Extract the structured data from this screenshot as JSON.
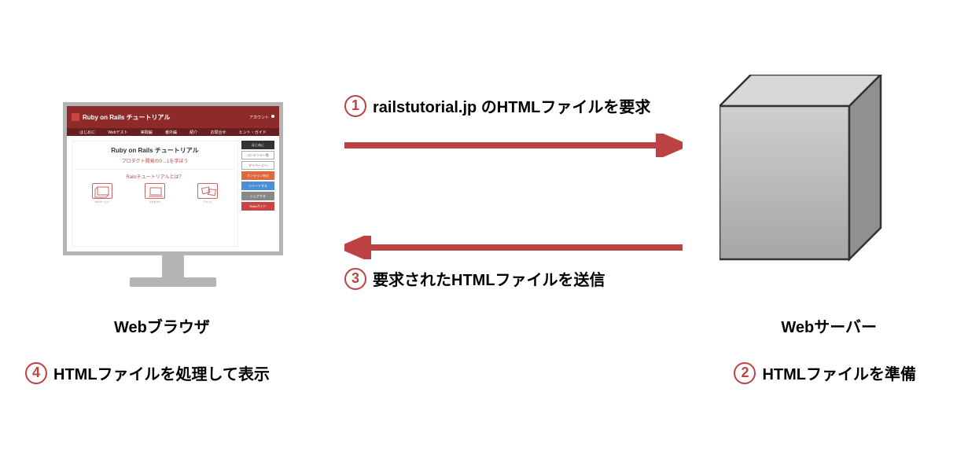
{
  "entities": {
    "browser": "Webブラウザ",
    "server": "Webサーバー"
  },
  "steps": {
    "s1": {
      "num": "1",
      "text": "railstutorial.jp のHTMLファイルを要求"
    },
    "s2": {
      "num": "2",
      "text": "HTMLファイルを準備"
    },
    "s3": {
      "num": "3",
      "text": "要求されたHTMLファイルを送信"
    },
    "s4": {
      "num": "4",
      "text": "HTMLファイルを処理して表示"
    }
  },
  "site_mock": {
    "title": "Ruby on Rails チュートリアル",
    "nav": [
      "はじめに",
      "Webテスト",
      "実践編",
      "番外編",
      "紹介",
      "お問合せ",
      "ヒント・ガイド"
    ],
    "main_heading": "Ruby on Rails チュートリアル",
    "main_sub": "プロダクト開発の0→1を学ぼう",
    "section": "Railsチュートリアルとは？",
    "sidebar": [
      "はじめに",
      "コンテンツ一覧",
      "マイページへ",
      "オンライン申込",
      "ツイートする",
      "シェアする",
      "Railsガイド"
    ],
    "header_menu": "アカウント"
  }
}
